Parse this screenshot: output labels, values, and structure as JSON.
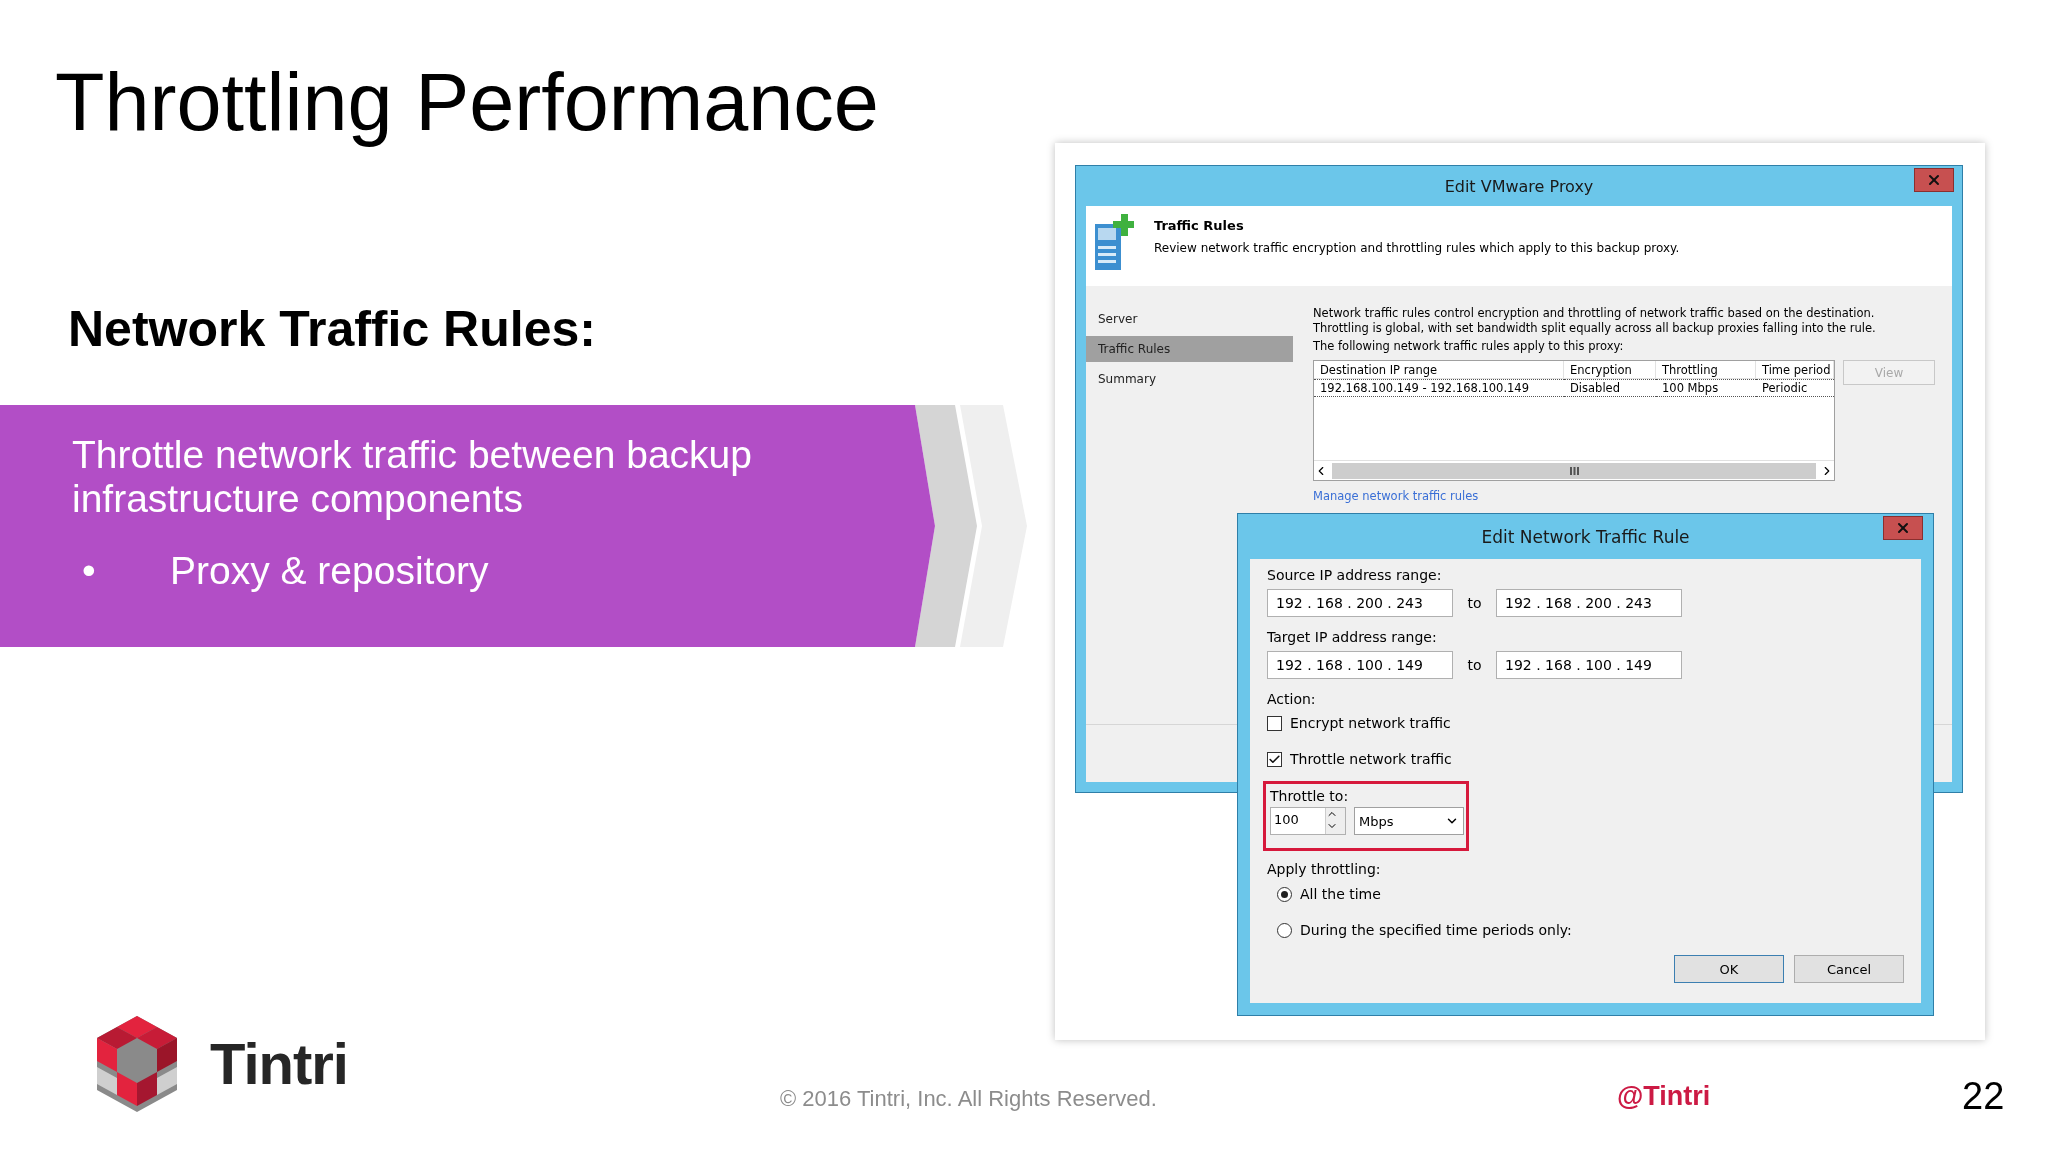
{
  "slide": {
    "title": "Throttling Performance",
    "heading": "Network Traffic Rules:",
    "banner": {
      "text": "Throttle network traffic between backup infrastructure components",
      "bullets": [
        {
          "marker": "•",
          "text": "Proxy & repository"
        }
      ]
    },
    "footer": {
      "logo_text": "Tintri",
      "copyright": "© 2016 Tintri, Inc. All Rights Reserved.",
      "handle": "@Tintri",
      "page_number": "22"
    }
  },
  "proxy_window": {
    "title": "Edit VMware Proxy",
    "header": {
      "title": "Traffic Rules",
      "description": "Review network traffic encryption and throttling rules which apply to this backup proxy."
    },
    "nav": [
      {
        "label": "Server",
        "selected": false
      },
      {
        "label": "Traffic Rules",
        "selected": true
      },
      {
        "label": "Summary",
        "selected": false
      }
    ],
    "intro": [
      "Network traffic rules control encryption and throttling of network traffic based on the destination.",
      "Throttling is global, with set bandwidth split equally across all backup proxies falling into the rule."
    ],
    "table_caption": "The following network traffic rules apply to this proxy:",
    "table": {
      "columns": [
        "Destination IP range",
        "Encryption",
        "Throttling",
        "Time period"
      ],
      "rows": [
        [
          "192.168.100.149 - 192.168.100.149",
          "Disabled",
          "100 Mbps",
          "Periodic"
        ]
      ]
    },
    "view_button": {
      "label": "View",
      "disabled": true
    },
    "manage_link": "Manage network traffic rules"
  },
  "rule_dialog": {
    "title": "Edit Network Traffic Rule",
    "ranges": [
      {
        "label": "Source IP address range:",
        "from": "192 . 168 . 200 . 243",
        "to_label": "to",
        "to": "192 . 168 . 200 . 243"
      },
      {
        "label": "Target IP address range:",
        "from": "192 . 168 . 100 . 149",
        "to_label": "to",
        "to": "192 . 168 . 100 . 149"
      }
    ],
    "action_label": "Action:",
    "actions": [
      {
        "label": "Encrypt network traffic",
        "checked": false
      },
      {
        "label": "Throttle network traffic",
        "checked": true
      }
    ],
    "throttle": {
      "label": "Throttle to:",
      "value": "100",
      "unit": "Mbps",
      "highlighted": true
    },
    "apply_label": "Apply throttling:",
    "apply_options": [
      {
        "label": "All the time",
        "selected": true
      },
      {
        "label": "During the specified time periods only:",
        "selected": false
      }
    ],
    "buttons": [
      {
        "label": "OK",
        "default": true
      },
      {
        "label": "Cancel",
        "default": false
      }
    ]
  }
}
